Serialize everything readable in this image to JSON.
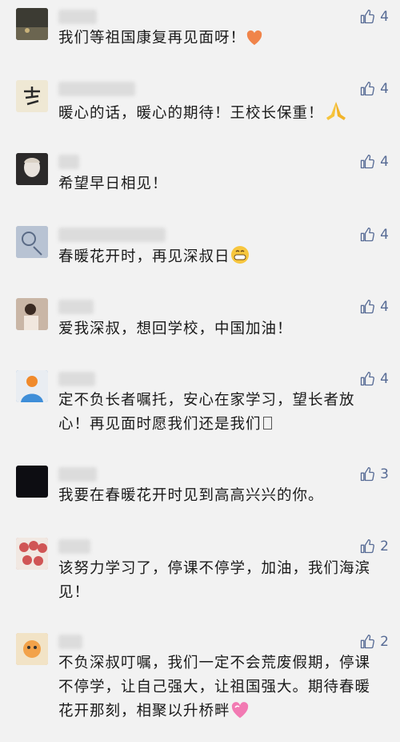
{
  "comments": [
    {
      "text": "我们等祖国康复再见面呀！",
      "likes": "4",
      "emoji": "heart-emoji",
      "avatar_color": "#4b4a3e"
    },
    {
      "text": "暖心的话，暖心的期待！王校长保重！",
      "likes": "4",
      "emoji": "pray-emoji",
      "avatar_color": "#efe8d4"
    },
    {
      "text": "希望早日相见！",
      "likes": "4",
      "emoji": "",
      "avatar_color": "#2c2a2a"
    },
    {
      "text": "春暖花开时，再见深叔日",
      "likes": "4",
      "emoji": "grin-emoji",
      "avatar_color": "#a8b5c7"
    },
    {
      "text": "爱我深叔，想回学校，中国加油！",
      "likes": "4",
      "emoji": "",
      "avatar_color": "#d9c7b8"
    },
    {
      "text": "定不负长者嘱托，安心在家学习，望长者放心！再见面时愿我们还是我们",
      "likes": "4",
      "emoji": "box-char",
      "avatar_color": "#4b88c8"
    },
    {
      "text": "我要在春暖花开时见到高高兴兴的你。",
      "likes": "3",
      "emoji": "",
      "avatar_color": "#0d0d12"
    },
    {
      "text": "该努力学习了，停课不停学，加油，我们海滨见！",
      "likes": "2",
      "emoji": "",
      "avatar_color": "#c97b7b"
    },
    {
      "text": "不负深叔叮嘱，我们一定不会荒废假期，停课不停学，让自己强大，让祖国强大。期待春暖花开那刻，相聚以升桥畔",
      "likes": "2",
      "emoji": "heart-pink-emoji",
      "avatar_color": "#d6a36a"
    }
  ]
}
